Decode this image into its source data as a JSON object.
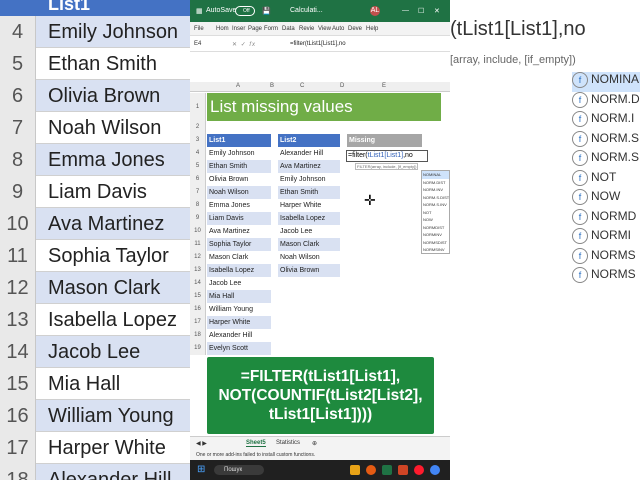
{
  "app": {
    "autosave_label": "AutoSave",
    "autosave_state": "Off",
    "file_name": "Calculati...",
    "user_initials": "AL"
  },
  "menu": [
    "File",
    "Hom",
    "Inser",
    "Page",
    "Form",
    "Data",
    "Revie",
    "View",
    "Auto",
    "Deve",
    "Help"
  ],
  "formula_bar": {
    "name_box": "E4",
    "fx_label": "fx",
    "formula": "=filter(tList1[List1],no"
  },
  "columns": [
    "A",
    "B",
    "C",
    "D",
    "E"
  ],
  "rows": [
    "1",
    "2",
    "3",
    "4",
    "5",
    "6",
    "7",
    "8",
    "9",
    "10",
    "11",
    "12",
    "13",
    "14",
    "15",
    "16",
    "17",
    "18",
    "19"
  ],
  "sheet_title": "List missing values",
  "list1": {
    "header": "List1",
    "items": [
      "Emily Johnson",
      "Ethan Smith",
      "Olivia Brown",
      "Noah Wilson",
      "Emma Jones",
      "Liam Davis",
      "Ava Martinez",
      "Sophia Taylor",
      "Mason Clark",
      "Isabella Lopez",
      "Jacob Lee",
      "Mia Hall",
      "William Young",
      "Harper White",
      "Alexander Hill",
      "Evelyn Scott"
    ]
  },
  "list2": {
    "header": "List2",
    "items": [
      "Alexander Hill",
      "Ava Martinez",
      "Emily Johnson",
      "Ethan Smith",
      "Harper White",
      "Isabella Lopez",
      "Jacob Lee",
      "Mason Clark",
      "Noah Wilson",
      "Olivia Brown"
    ]
  },
  "missing": {
    "header": "Missing",
    "formula_prefix": "=filter(",
    "formula_ref": "tList1[List1]",
    "formula_suffix": ",no",
    "hint": "FILTER(array, include, [if_empty])"
  },
  "autocomplete": [
    "NOMINAL",
    "NORM.DIST",
    "NORM.INV",
    "NORM.S.DIST",
    "NORM.S.INV",
    "NOT",
    "NOW",
    "NORMDIST",
    "NORMINV",
    "NORMSDIST",
    "NORMSINV"
  ],
  "overlay_formula": [
    "=FILTER(tList1[List1],",
    "NOT(COUNTIF(tList2[List2],",
    "tList1[List1])))"
  ],
  "tabs": [
    "Sheet5",
    "Statistics"
  ],
  "status_text": "One or more add-ins failed to install custom functions.",
  "taskbar": {
    "search_placeholder": "Пошук"
  },
  "zoom_left": {
    "header": "List1",
    "rows": [
      "4",
      "5",
      "6",
      "7",
      "8",
      "9",
      "10",
      "11",
      "12",
      "13",
      "14",
      "15",
      "16",
      "17",
      "18"
    ],
    "names": [
      "Emily Johnson",
      "Ethan Smith",
      "Olivia Brown",
      "Noah Wilson",
      "Emma Jones",
      "Liam Davis",
      "Ava Martinez",
      "Sophia Taylor",
      "Mason Clark",
      "Isabella Lopez",
      "Jacob Lee",
      "Mia Hall",
      "William Young",
      "Harper White",
      "Alexander Hill"
    ]
  },
  "zoom_right": {
    "formula": "(tList1[List1],no",
    "hint": "[array, include, [if_empty])",
    "items": [
      "NOMINAL",
      "NORM.D",
      "NORM.I",
      "NORM.S",
      "NORM.S",
      "NOT",
      "NOW",
      "NORMD",
      "NORMI",
      "NORMS",
      "NORMS"
    ]
  },
  "colors": {
    "excel_green": "#1f7244",
    "table_blue": "#4472c4",
    "band_blue": "#d9e1f2",
    "title_green": "#70ad47",
    "overlay_green": "#1e8a3e"
  }
}
